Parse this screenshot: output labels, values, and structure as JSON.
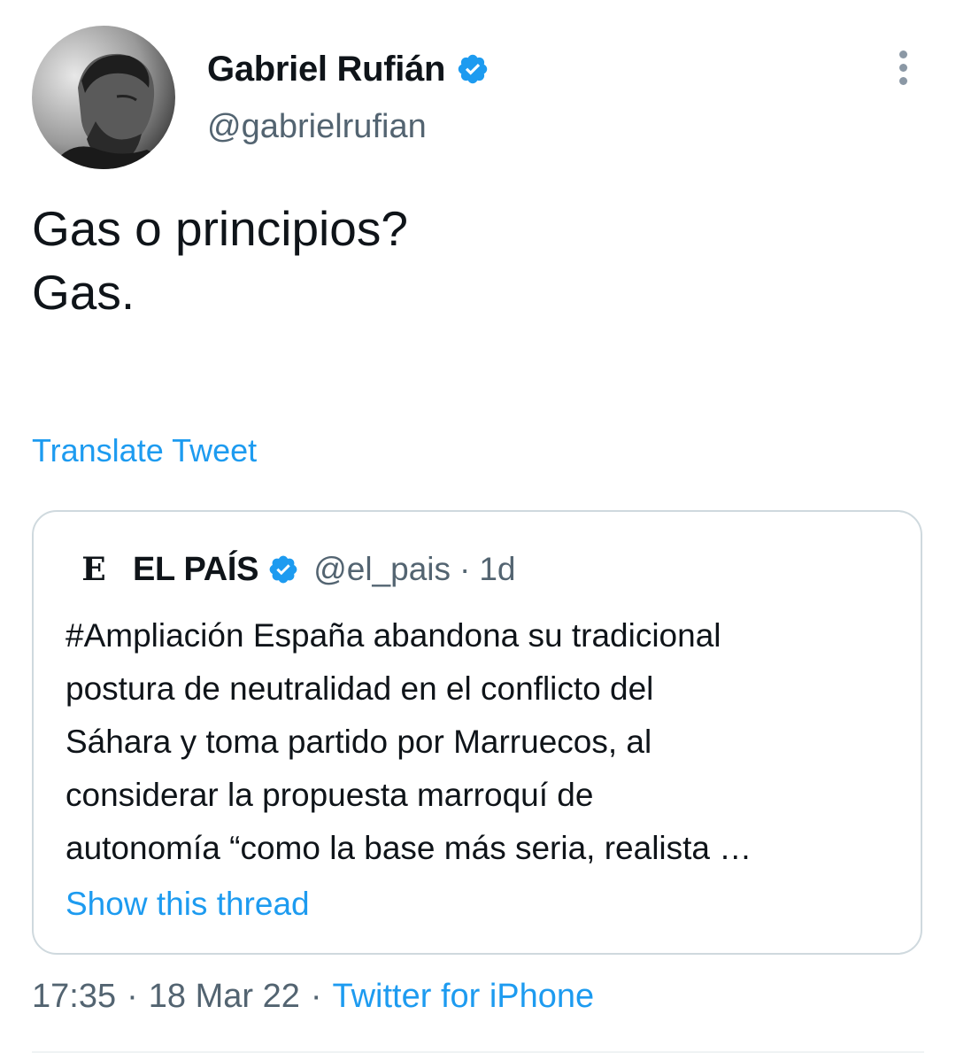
{
  "tweet": {
    "author": {
      "name": "Gabriel Rufián",
      "handle": "@gabrielrufian",
      "verified": true,
      "avatar_icon": "profile-photo"
    },
    "text_lines": [
      "Gas o principios?",
      "",
      "Gas."
    ],
    "translate_label": "Translate Tweet",
    "timestamp": "17:35",
    "date": "18 Mar 22",
    "separator": "·",
    "source": "Twitter for iPhone",
    "more_icon": "more-vertical-icon"
  },
  "quote": {
    "logo_letter": "E",
    "name": "EL PAÍS",
    "verified": true,
    "handle": "@el_pais",
    "separator": "·",
    "time": "1d",
    "text_lines": [
      "#Ampliación España abandona su tradicional",
      "postura de neutralidad en el conflicto del",
      "Sáhara y toma partido por Marruecos, al",
      "considerar la propuesta marroquí de",
      "autonomía “como la base más seria, realista …"
    ],
    "show_thread_label": "Show this thread"
  },
  "colors": {
    "text_primary": "#0f1419",
    "text_secondary": "#536471",
    "link": "#1d9bf0",
    "verified_badge": "#1d9bf0",
    "border": "#cfd9de"
  }
}
